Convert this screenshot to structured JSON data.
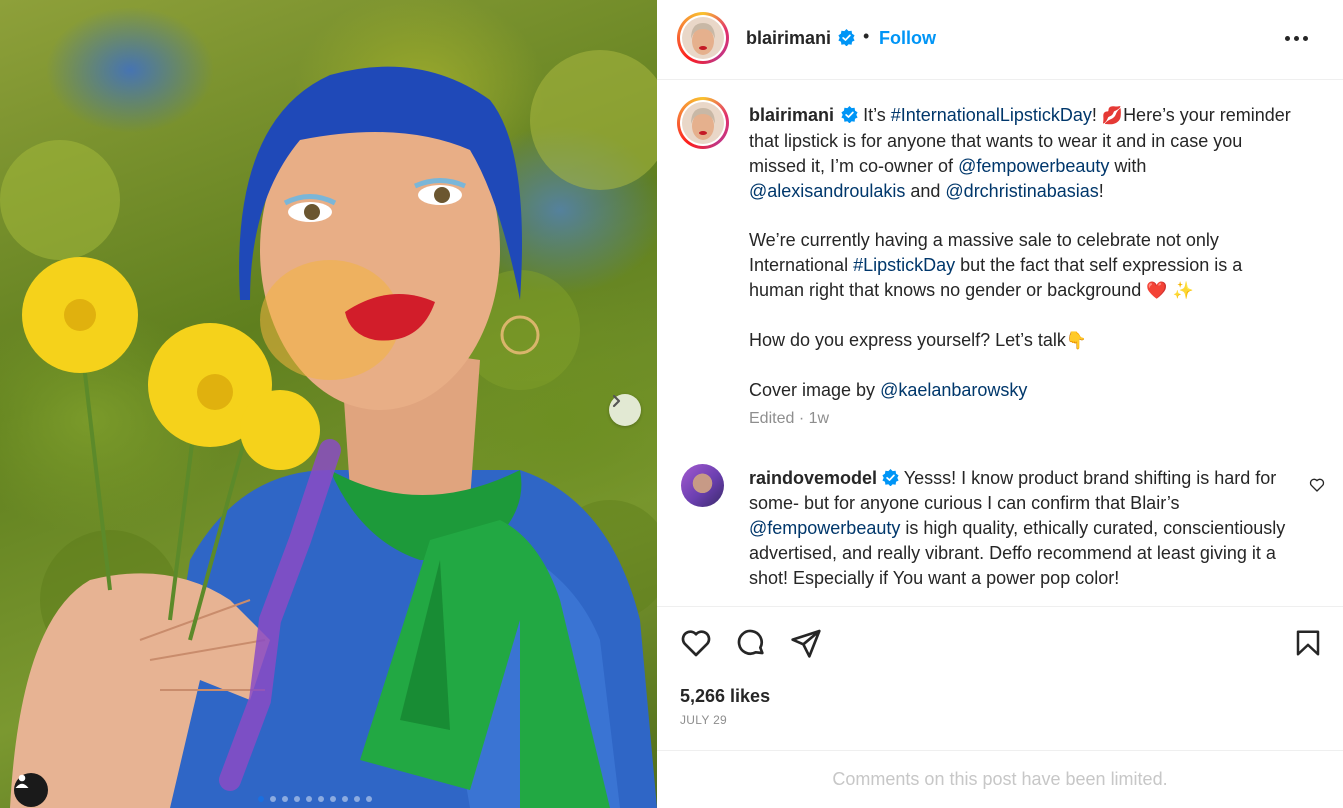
{
  "post": {
    "username": "blairimani",
    "verified": true,
    "separator": "•",
    "follow_label": "Follow",
    "more_label": "More options",
    "image": {
      "carousel_slides": 10,
      "active_slide": 1,
      "next_label": "Next"
    }
  },
  "caption": {
    "username": "blairimani",
    "p1_pre": "It’s ",
    "p1_tag": "#InternationalLipstickDay",
    "p1_mid": "! ",
    "p1_emoji": "💋",
    "p1_text": "Here’s your reminder that lipstick is for anyone that wants to wear it and in case you missed it, I’m co-owner of ",
    "p1_mention1": "@fempowerbeauty",
    "p1_with": " with ",
    "p1_mention2": "@alexisandroulakis",
    "p1_and": " and ",
    "p1_mention3": "@drchristinabasias",
    "p1_end": "!",
    "p2_pre": "We’re currently having a massive sale to celebrate not only International ",
    "p2_tag": "#LipstickDay",
    "p2_post": " but the fact that self expression is a human right that knows no gender or background ",
    "p2_emoji": "❤️ ✨",
    "p3": "How do you express yourself? Let’s talk",
    "p3_emoji": "👇",
    "p4_pre": "Cover image by ",
    "p4_mention": "@kaelanbarowsky",
    "meta": "Edited · 1w"
  },
  "comment": {
    "username": "raindovemodel",
    "text_pre": "Yesss! I know product brand shifting is hard for some- but for anyone curious I can confirm that Blair’s ",
    "mention": "@fempowerbeauty",
    "text_post": " is high quality, ethically curated, conscientiously advertised, and really vibrant. Deffo recommend at least giving it a shot! Especially if You want a power pop color!"
  },
  "actions": {
    "likes": "5,266 likes",
    "date": "JULY 29",
    "limited": "Comments on this post have been limited."
  },
  "colors": {
    "accent": "#0095f6",
    "link": "#00376b",
    "muted": "#8e8e8e"
  },
  "icons": [
    "verified-badge-icon",
    "more-icon",
    "heart-icon",
    "comment-icon",
    "share-icon",
    "save-icon",
    "chevron-right-icon",
    "user-tag-icon"
  ]
}
